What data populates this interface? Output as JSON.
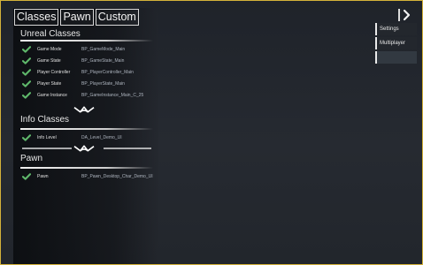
{
  "tabs": {
    "classes": "Classes",
    "pawn": "Pawn",
    "custom": "Custom"
  },
  "unreal_classes": {
    "title": "Unreal Classes",
    "rows": [
      {
        "label": "Game Mode",
        "value": "BP_GameMode_Main"
      },
      {
        "label": "Game State",
        "value": "BP_GameState_Main"
      },
      {
        "label": "Player Controller",
        "value": "BP_PlayerController_Main"
      },
      {
        "label": "Player State",
        "value": "BP_PlayerState_Main"
      },
      {
        "label": "Game Instance",
        "value": "BP_GameInstance_Main_C_25"
      }
    ]
  },
  "info_classes": {
    "title": "Info Classes",
    "rows": [
      {
        "label": "Info Level",
        "value": "DA_Level_Demo_UI"
      }
    ]
  },
  "pawn": {
    "title": "Pawn",
    "rows": [
      {
        "label": "Pawn",
        "value": "BP_Pawn_Desktop_Char_Demo_UI"
      }
    ]
  },
  "right_menu": {
    "items": [
      {
        "label": "Settings"
      },
      {
        "label": "Multiplayer"
      }
    ]
  },
  "colors": {
    "accent": "#d4b23a",
    "check": "#5fb86b",
    "muted_text": "#aeb5bf"
  },
  "icons": {
    "close": "close-chevron-icon",
    "check": "check-icon",
    "divider": "ornament-icon"
  }
}
